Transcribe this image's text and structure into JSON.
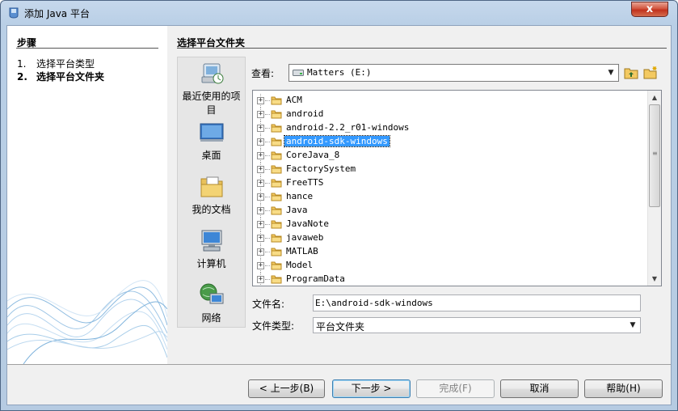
{
  "window": {
    "title": "添加 Java 平台",
    "close_glyph": "x"
  },
  "steps": {
    "title": "步骤",
    "items": [
      {
        "num": "1.",
        "label": "选择平台类型"
      },
      {
        "num": "2.",
        "label": "选择平台文件夹"
      }
    ]
  },
  "content": {
    "title": "选择平台文件夹"
  },
  "places": [
    {
      "label": "最近使用的项目",
      "icon": "recent-items-icon"
    },
    {
      "label": "桌面",
      "icon": "desktop-icon"
    },
    {
      "label": "我的文档",
      "icon": "documents-icon"
    },
    {
      "label": "计算机",
      "icon": "computer-icon"
    },
    {
      "label": "网络",
      "icon": "network-icon"
    }
  ],
  "lookin": {
    "label": "查看:",
    "value": "Matters (E:)"
  },
  "files": [
    {
      "name": "ACM",
      "selected": false
    },
    {
      "name": "android",
      "selected": false
    },
    {
      "name": "android-2.2_r01-windows",
      "selected": false
    },
    {
      "name": "android-sdk-windows",
      "selected": true
    },
    {
      "name": "CoreJava_8",
      "selected": false
    },
    {
      "name": "FactorySystem",
      "selected": false
    },
    {
      "name": "FreeTTS",
      "selected": false
    },
    {
      "name": "hance",
      "selected": false
    },
    {
      "name": "Java",
      "selected": false
    },
    {
      "name": "JavaNote",
      "selected": false
    },
    {
      "name": "javaweb",
      "selected": false
    },
    {
      "name": "MATLAB",
      "selected": false
    },
    {
      "name": "Model",
      "selected": false
    },
    {
      "name": "ProgramData",
      "selected": false
    }
  ],
  "filename": {
    "label": "文件名:",
    "value": "E:\\android-sdk-windows"
  },
  "filetype": {
    "label": "文件类型:",
    "value": "平台文件夹"
  },
  "buttons": {
    "back": "< 上一步(B)",
    "next": "下一步 >",
    "finish": "完成(F)",
    "cancel": "取消",
    "help": "帮助(H)"
  },
  "colors": {
    "selection": "#3399ff",
    "folder": "#f3c961"
  }
}
